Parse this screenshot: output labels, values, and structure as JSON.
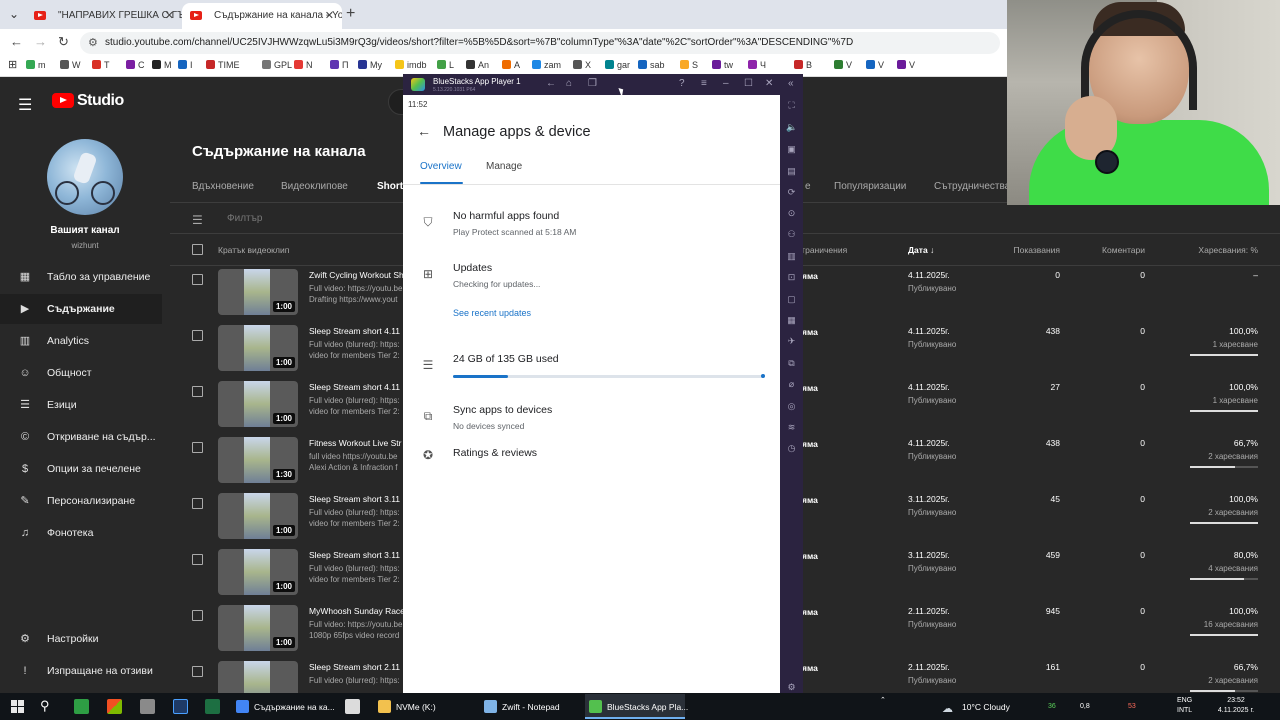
{
  "browser": {
    "tabs": [
      {
        "label": "\"НАПРАВИХ ГРЕШКА С ГЪМОВ"
      },
      {
        "label": "Съдържание на канала - YouTube"
      }
    ],
    "url": "studio.youtube.com/channel/UC25IVJHWWzqwLu5i3M9rQ3g/videos/short?filter=%5B%5D&sort=%7B\"columnType\"%3A\"date\"%2C\"sortOrder\"%3A\"DESCENDING\"%7D",
    "bookmarks": [
      {
        "label": "m",
        "color": "#34a853"
      },
      {
        "label": "W",
        "color": "#555555"
      },
      {
        "label": "T",
        "color": "#d93025"
      },
      {
        "label": "C",
        "color": "#7b1fa2"
      },
      {
        "label": "M",
        "color": "#222222"
      },
      {
        "label": "I",
        "color": "#1565c0"
      },
      {
        "label": "TIME",
        "color": "#c62828"
      },
      {
        "label": "GPL",
        "color": "#757575"
      },
      {
        "label": "N",
        "color": "#e53935"
      },
      {
        "label": "П",
        "color": "#5e35b1"
      },
      {
        "label": "My",
        "color": "#283593"
      },
      {
        "label": "imdb",
        "color": "#f5c518"
      },
      {
        "label": "L",
        "color": "#43a047"
      },
      {
        "label": "An",
        "color": "#333333"
      },
      {
        "label": "A",
        "color": "#ef6c00"
      },
      {
        "label": "zam",
        "color": "#1e88e5"
      },
      {
        "label": "X",
        "color": "#555555"
      },
      {
        "label": "gar",
        "color": "#00838f"
      },
      {
        "label": "sab",
        "color": "#1565c0"
      },
      {
        "label": "S",
        "color": "#f9a825"
      },
      {
        "label": "tw",
        "color": "#6a1b9a"
      },
      {
        "label": "Ч",
        "color": "#8e24aa"
      },
      {
        "label": "B",
        "color": "#c62828"
      },
      {
        "label": "V",
        "color": "#2e7d32"
      },
      {
        "label": "V",
        "color": "#1565c0"
      },
      {
        "label": "V",
        "color": "#6a1b9a"
      }
    ]
  },
  "studio": {
    "app_title": "Studio",
    "channel_name": "Вашият канал",
    "channel_handle": "wizhunt",
    "nav": [
      {
        "label": "Табло за управление",
        "icon": "▦"
      },
      {
        "label": "Съдържание",
        "icon": "▶"
      },
      {
        "label": "Analytics",
        "icon": "▥"
      },
      {
        "label": "Общност",
        "icon": "☺"
      },
      {
        "label": "Езици",
        "icon": "☰"
      },
      {
        "label": "Откриване на съдър...",
        "icon": "©"
      },
      {
        "label": "Опции за печелене",
        "icon": "$"
      },
      {
        "label": "Персонализиране",
        "icon": "✎"
      },
      {
        "label": "Фонотека",
        "icon": "♫"
      }
    ],
    "nav_bottom": [
      {
        "label": "Настройки",
        "icon": "⚙"
      },
      {
        "label": "Изпращане на отзиви",
        "icon": "!"
      }
    ],
    "page_title": "Съдържание на канала",
    "content_tabs": [
      "Вдъхновение",
      "Видеоклипове",
      "Shorts",
      "е",
      "Популяризации",
      "Сътрудничества"
    ],
    "filter_label": "Филтър",
    "columns": {
      "video": "Кратък видеоклип",
      "restrictions": "граничения",
      "date": "Дата ↓",
      "views": "Показвания",
      "comments": "Коментари",
      "likes": "Харесвания: %"
    },
    "rows": [
      {
        "title": "Zwift Cycling Workout Sh",
        "desc1": "Full video: https://youtu.be",
        "desc2": "Drafting https://www.yout",
        "duration": "1:00",
        "visibility": "яма",
        "date": "4.11.2025г.",
        "status": "Публикувано",
        "views": "0",
        "comments": "0",
        "likes": "–",
        "like_count": "",
        "like_fraction": 0
      },
      {
        "title": "Sleep Stream short 4.11",
        "desc1": "Full video (blurred): https:",
        "desc2": "video for members Tier 2:",
        "duration": "1:00",
        "visibility": "яма",
        "date": "4.11.2025г.",
        "status": "Публикувано",
        "views": "438",
        "comments": "0",
        "likes": "100,0%",
        "like_count": "1 харесване",
        "like_fraction": 1.0
      },
      {
        "title": "Sleep Stream short 4.11",
        "desc1": "Full video (blurred): https:",
        "desc2": "video for members Tier 2:",
        "duration": "1:00",
        "visibility": "яма",
        "date": "4.11.2025г.",
        "status": "Публикувано",
        "views": "27",
        "comments": "0",
        "likes": "100,0%",
        "like_count": "1 харесване",
        "like_fraction": 1.0
      },
      {
        "title": "Fitness Workout Live Str",
        "desc1": "full video https://youtu.be",
        "desc2": "Alexi Action & Infraction f",
        "duration": "1:30",
        "visibility": "яма",
        "date": "4.11.2025г.",
        "status": "Публикувано",
        "views": "438",
        "comments": "0",
        "likes": "66,7%",
        "like_count": "2 харесвания",
        "like_fraction": 0.667
      },
      {
        "title": "Sleep Stream short 3.11",
        "desc1": "Full video (blurred): https:",
        "desc2": "video for members Tier 2:",
        "duration": "1:00",
        "visibility": "яма",
        "date": "3.11.2025г.",
        "status": "Публикувано",
        "views": "45",
        "comments": "0",
        "likes": "100,0%",
        "like_count": "2 харесвания",
        "like_fraction": 1.0
      },
      {
        "title": "Sleep Stream short 3.11",
        "desc1": "Full video (blurred): https:",
        "desc2": "video for members Tier 2:",
        "duration": "1:00",
        "visibility": "яма",
        "date": "3.11.2025г.",
        "status": "Публикувано",
        "views": "459",
        "comments": "0",
        "likes": "80,0%",
        "like_count": "4 харесвания",
        "like_fraction": 0.8
      },
      {
        "title": "MyWhoosh Sunday Race",
        "desc1": "Full video: https://youtu.be",
        "desc2": "1080p 65fps video record",
        "duration": "1:00",
        "visibility": "яма",
        "date": "2.11.2025г.",
        "status": "Публикувано",
        "views": "945",
        "comments": "0",
        "likes": "100,0%",
        "like_count": "16 харесвания",
        "like_fraction": 1.0
      },
      {
        "title": "Sleep Stream short 2.11",
        "desc1": "Full video (blurred): https:",
        "desc2": "",
        "duration": "1:00",
        "visibility": "яма",
        "date": "2.11.2025г.",
        "status": "Публикувано",
        "views": "161",
        "comments": "0",
        "likes": "66,7%",
        "like_count": "2 харесвания",
        "like_fraction": 0.667
      }
    ]
  },
  "bluestacks": {
    "title": "BlueStacks App Player 1",
    "version": "5.13.220.1031 P64",
    "time": "11:52",
    "screen_title": "Manage apps & device",
    "tabs": [
      "Overview",
      "Manage"
    ],
    "protect_title": "No harmful apps found",
    "protect_sub": "Play Protect scanned at 5:18 AM",
    "updates_title": "Updates",
    "updates_sub": "Checking for updates...",
    "updates_link": "See recent updates",
    "storage_title": "24 GB of 135 GB used",
    "storage_used_gb": 24,
    "storage_total_gb": 135,
    "sync_title": "Sync apps to devices",
    "sync_sub": "No devices synced",
    "ratings_title": "Ratings & reviews",
    "accent_color": "#1a73c8"
  },
  "taskbar": {
    "apps": [
      {
        "label": "Съдържание на ка...",
        "color": "#4285f4"
      },
      {
        "label": "NVMe (K:)",
        "color": "#f2c14e"
      },
      {
        "label": "Zwift - Notepad",
        "color": "#7fb3e6"
      },
      {
        "label": "BlueStacks App Pla...",
        "color": "#53c04e"
      }
    ],
    "weather": "10°C  Cloudy",
    "tray_numbers": [
      "36",
      "0,8",
      "53"
    ],
    "lang1": "ENG",
    "lang2": "INTL",
    "clock_time": "23:52",
    "clock_date": "4.11.2025 г."
  }
}
